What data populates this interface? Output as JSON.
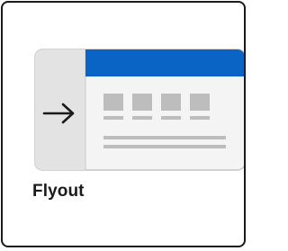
{
  "card": {
    "label": "Flyout",
    "icon": "flyout-layout-illustration",
    "colors": {
      "accent": "#0a64c6",
      "panel_fill": "#e3e3e3",
      "surface": "#f4f4f4",
      "placeholder_block": "#bdbdbd",
      "border": "#1a1a1a"
    }
  }
}
